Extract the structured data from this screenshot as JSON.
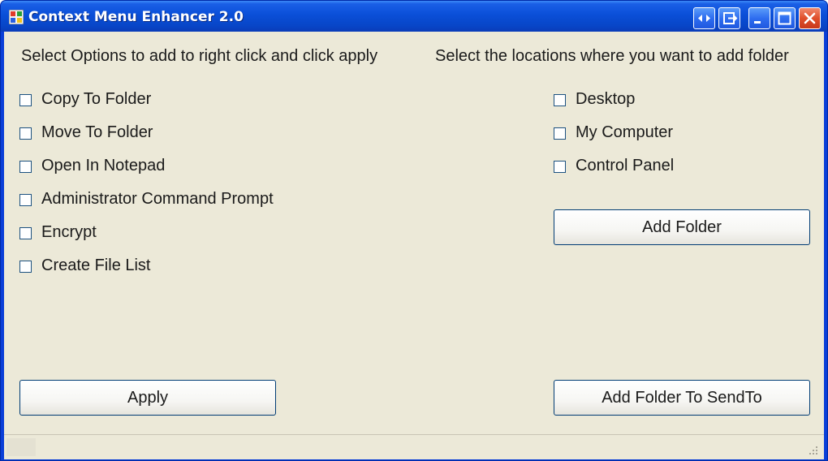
{
  "window": {
    "title": "Context Menu Enhancer 2.0",
    "titlebar_buttons": [
      "restore-arrows-icon",
      "exit-icon",
      "minimize-icon",
      "maximize-icon",
      "close-icon"
    ]
  },
  "left_panel": {
    "instruction": "Select Options to add to right click and click apply",
    "options": [
      {
        "label": "Copy To Folder",
        "checked": false
      },
      {
        "label": "Move To Folder",
        "checked": false
      },
      {
        "label": "Open In Notepad",
        "checked": false
      },
      {
        "label": "Administrator Command Prompt",
        "checked": false
      },
      {
        "label": "Encrypt",
        "checked": false
      },
      {
        "label": "Create File List",
        "checked": false
      }
    ],
    "apply_label": "Apply"
  },
  "right_panel": {
    "instruction": "Select the locations where you want to add folder",
    "locations": [
      {
        "label": "Desktop",
        "checked": false
      },
      {
        "label": "My Computer",
        "checked": false
      },
      {
        "label": "Control Panel",
        "checked": false
      }
    ],
    "add_folder_label": "Add Folder",
    "add_sendto_label": "Add Folder To SendTo"
  },
  "colors": {
    "titlebar": "#0a4fd8",
    "client_bg": "#ece9d8",
    "close_button": "#e0502c"
  }
}
